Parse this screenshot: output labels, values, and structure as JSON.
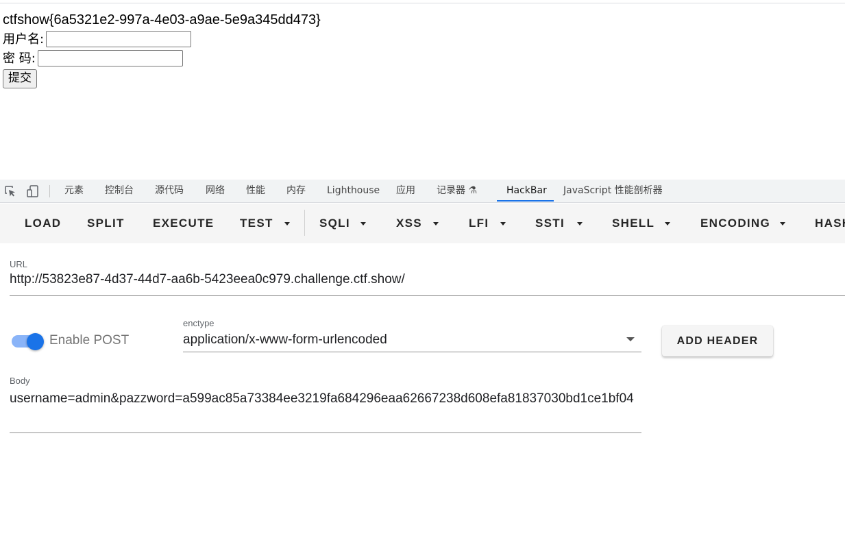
{
  "page": {
    "flag": "ctfshow{6a5321e2-997a-4e03-a9ae-5e9a345dd473}",
    "username_label": "用户名:",
    "password_label": "密 码:",
    "submit_label": "提交"
  },
  "devtools": {
    "tabs": [
      "元素",
      "控制台",
      "源代码",
      "网络",
      "性能",
      "内存",
      "Lighthouse",
      "应用",
      "记录器 ⚗",
      "HackBar",
      "JavaScript 性能剖析器"
    ],
    "active_tab": "HackBar"
  },
  "hackbar": {
    "toolbar": [
      "LOAD",
      "SPLIT",
      "EXECUTE",
      "TEST",
      "SQLI",
      "XSS",
      "LFI",
      "SSTI",
      "SHELL",
      "ENCODING",
      "HASH"
    ],
    "url_label": "URL",
    "url_value": "http://53823e87-4d37-44d7-aa6b-5423eea0c979.challenge.ctf.show/",
    "enable_post_label": "Enable POST",
    "enable_post": true,
    "enctype_label": "enctype",
    "enctype_value": "application/x-www-form-urlencoded",
    "add_header_label": "ADD HEADER",
    "body_label": "Body",
    "body_value": "username=admin&pazzword=a599ac85a73384ee3219fa684296eaa62667238d608efa81837030bd1ce1bf04"
  },
  "colors": {
    "accent": "#1a73e8",
    "toolbar_bg": "#f5f5f5",
    "tabbar_bg": "#f1f3f4"
  }
}
